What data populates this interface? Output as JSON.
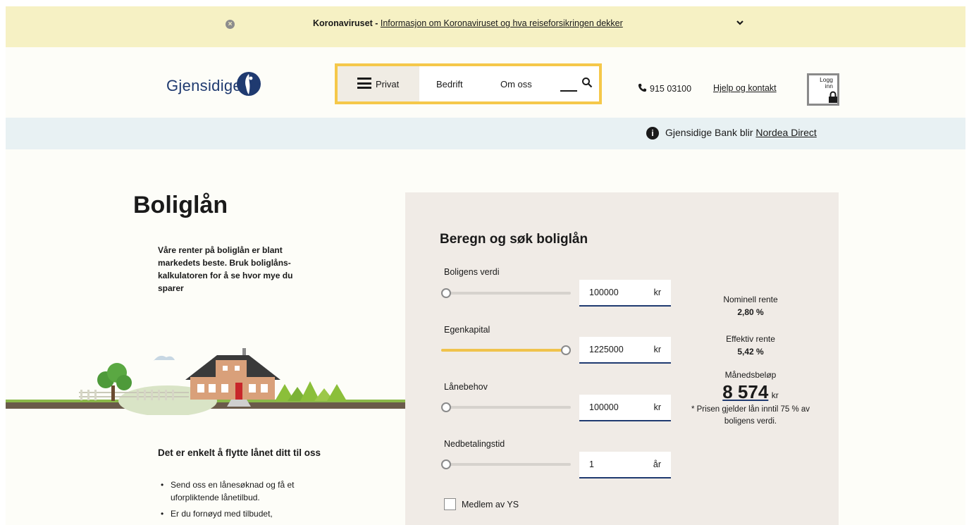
{
  "alert": {
    "prefix": "Koronaviruset -",
    "link": "Informasjon om Koronaviruset og hva reiseforsikringen dekker"
  },
  "header": {
    "logo_text": "Gjensidige",
    "nav": {
      "privat": "Privat",
      "bedrift": "Bedrift",
      "om_oss": "Om oss"
    },
    "phone": "915 03100",
    "help": "Hjelp og kontakt",
    "login": "Logg inn"
  },
  "infobar": {
    "text": "Gjensidige Bank blir",
    "link": "Nordea Direct"
  },
  "main": {
    "title": "Boliglån",
    "intro": "Våre renter på boliglån er blant markedets beste. Bruk boliglåns-kalkulatoren for å se hvor mye du sparer",
    "subheading": "Det er enkelt å flytte lånet ditt til oss",
    "bullets": [
      "Send oss en lånesøknad og få et uforpliktende lånetilbud.",
      "Er du fornøyd med tilbudet,"
    ]
  },
  "calculator": {
    "title": "Beregn og søk boliglån",
    "fields": [
      {
        "label": "Boligens verdi",
        "value": "100000",
        "unit": "kr",
        "slider_fraction": 0
      },
      {
        "label": "Egenkapital",
        "value": "1225000",
        "unit": "kr",
        "slider_fraction": 1
      },
      {
        "label": "Lånebehov",
        "value": "100000",
        "unit": "kr",
        "slider_fraction": 0
      },
      {
        "label": "Nedbetalingstid",
        "value": "1",
        "unit": "år",
        "slider_fraction": 0
      }
    ],
    "nominal_label": "Nominell rente",
    "nominal_value": "2,80 %",
    "effective_label": "Effektiv rente",
    "effective_value": "5,42 %",
    "monthly_label": "Månedsbeløp",
    "monthly_value": "8 574",
    "monthly_unit": "kr",
    "note": "* Prisen gjelder lån inntil 75 % av boligens verdi.",
    "checkbox_label": "Medlem av YS"
  },
  "colors": {
    "accent": "#f5c84a",
    "brand": "#1f3a70",
    "alert_bg": "#f6f1c4",
    "info_bg": "#e8f1f3",
    "calc_bg": "#f0ebe6"
  }
}
